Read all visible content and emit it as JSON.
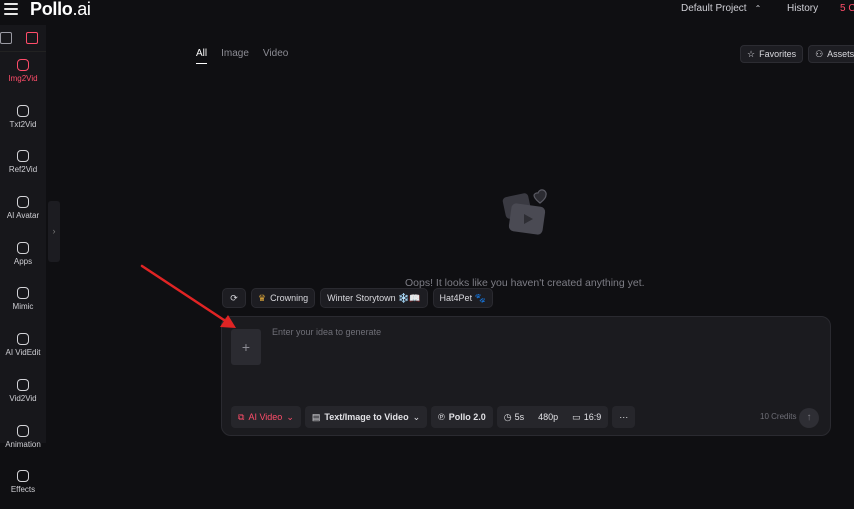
{
  "header": {
    "logo_main": "Pollo",
    "logo_suffix": ".ai",
    "project": "Default Project",
    "history": "History",
    "credits_short": "5 C"
  },
  "sidebar": {
    "items": [
      {
        "label": "Img2Vid",
        "active": true
      },
      {
        "label": "Txt2Vid"
      },
      {
        "label": "Ref2Vid"
      },
      {
        "label": "AI Avatar"
      },
      {
        "label": "Apps"
      },
      {
        "label": "Mimic"
      },
      {
        "label": "AI VidEdit"
      },
      {
        "label": "Vid2Vid"
      },
      {
        "label": "Animation"
      },
      {
        "label": "Effects"
      }
    ]
  },
  "tabs": [
    "All",
    "Image",
    "Video"
  ],
  "actions": {
    "favorites": "Favorites",
    "assets": "Assets"
  },
  "empty": {
    "message": "Oops! It looks like you haven't created anything yet."
  },
  "suggestions": [
    "Crowning",
    "Winter Storytown ❄️📖",
    "Hat4Pet 🐾"
  ],
  "prompt": {
    "placeholder": "Enter your idea to generate"
  },
  "toolbar": {
    "ai_video": "AI Video",
    "mode": "Text/Image to Video",
    "model": "Pollo 2.0",
    "duration": "5s",
    "resolution": "480p",
    "ratio": "16:9",
    "more": "···",
    "credits": "10 Credits"
  },
  "colors": {
    "accent": "#ff4d6a",
    "background": "#0f0f12",
    "annotation_arrow": "#e02424"
  }
}
